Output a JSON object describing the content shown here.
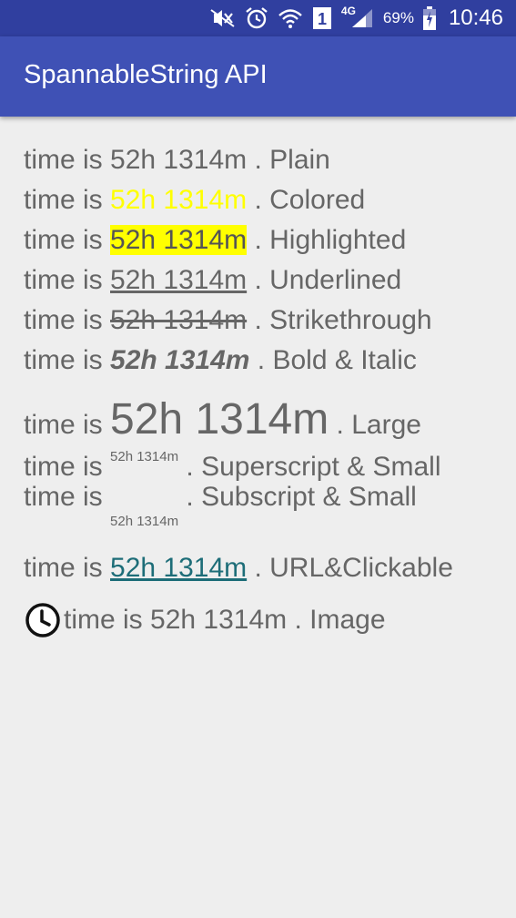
{
  "status_bar": {
    "sim_label": "1",
    "network": "4G",
    "battery": "69%",
    "time": "10:46",
    "icons": [
      "mute-icon",
      "alarm-icon",
      "wifi-icon",
      "sim-icon",
      "signal-icon",
      "battery-icon"
    ]
  },
  "app_bar": {
    "title": "SpannableString API"
  },
  "colors": {
    "status_bar": "#303f9f",
    "app_bar": "#3f51b5",
    "text": "#666666",
    "yellow": "#ffff00",
    "link": "#1d6d78"
  },
  "lines": {
    "plain": {
      "prefix": "time is ",
      "span": "52h 1314m",
      "suffix": " . Plain"
    },
    "colored": {
      "prefix": "time is ",
      "span": "52h 1314m",
      "suffix": " . Colored"
    },
    "highlighted": {
      "prefix": "time is ",
      "span": "52h 1314m",
      "suffix": " . Highlighted"
    },
    "underlined": {
      "prefix": "time is ",
      "span": "52h 1314m",
      "suffix": " . Underlined"
    },
    "strikethrough": {
      "prefix": "time is ",
      "span": "52h 1314m",
      "suffix": " . Strikethrough"
    },
    "bold_italic": {
      "prefix": "time is ",
      "span": "52h 1314m",
      "suffix": " . Bold & Italic"
    },
    "large": {
      "prefix": "time is ",
      "span": "52h 1314m",
      "suffix": " . Large"
    },
    "superscript": {
      "prefix": "time is ",
      "span": "52h 1314m",
      "suffix": " . Superscript & Small"
    },
    "subscript": {
      "prefix": "time is ",
      "span": "52h 1314m",
      "suffix": " . Subscript & Small"
    },
    "url": {
      "prefix": "time is ",
      "span": "52h 1314m",
      "suffix": " . URL&Clickable"
    },
    "image": {
      "icon": "clock-icon",
      "text": "time is 52h 1314m . Image"
    }
  }
}
